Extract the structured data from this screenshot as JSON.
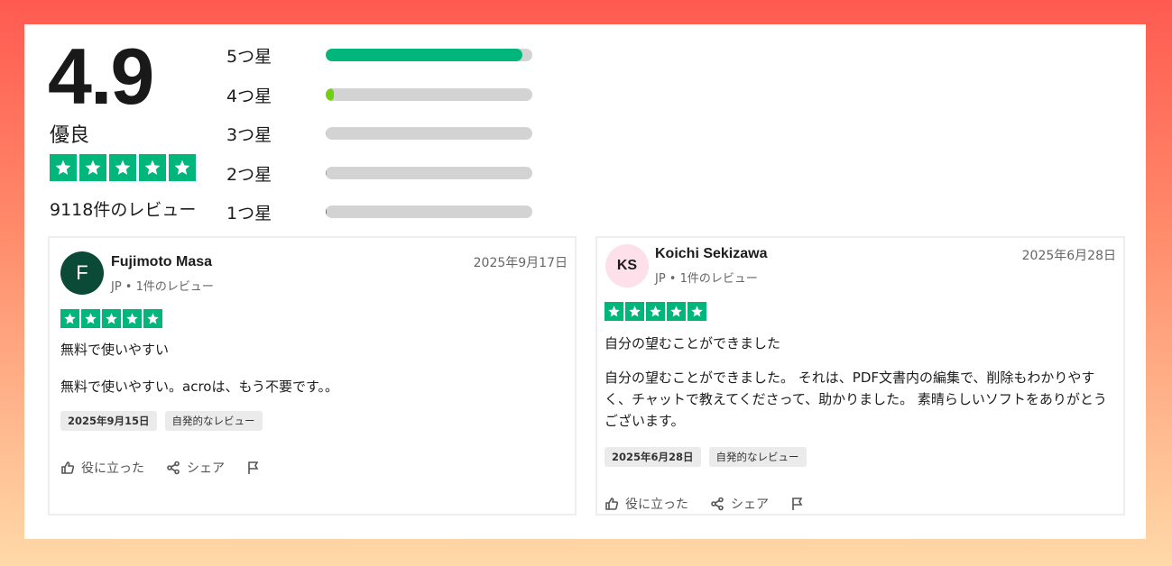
{
  "summary": {
    "score": "4.9",
    "rating_word": "優良",
    "review_count": "9118件のレビュー",
    "star_count": 5,
    "star_color": "#00b67a"
  },
  "distribution": [
    {
      "label": "5つ星",
      "percent": 95,
      "color": "#00b67a"
    },
    {
      "label": "4つ星",
      "percent": 4,
      "color": "#73cf11"
    },
    {
      "label": "3つ星",
      "percent": 0.5,
      "color": "#ffce00"
    },
    {
      "label": "2つ星",
      "percent": 0.5,
      "color": "#ff8622"
    },
    {
      "label": "1つ星",
      "percent": 0.5,
      "color": "#ff3722"
    }
  ],
  "reviews": [
    {
      "avatar": "F",
      "name": "Fujimoto Masa",
      "meta": "JP • 1件のレビュー",
      "date": "2025年9月17日",
      "title": "無料で使いやすい",
      "body": "無料で使いやすい。acroは、もう不要です。。",
      "chip_date": "2025年9月15日",
      "chip_type": "自発的なレビュー",
      "helpful": "役に立った",
      "share": "シェア"
    },
    {
      "avatar": "KS",
      "name": "Koichi Sekizawa",
      "meta": "JP • 1件のレビュー",
      "date": "2025年6月28日",
      "title": "自分の望むことができました",
      "body": "自分の望むことができました。 それは、PDF文書内の編集で、削除もわかりやすく、チャットで教えてくださって、助かりました。 素晴らしいソフトをありがとうございます。",
      "chip_date": "2025年6月28日",
      "chip_type": "自発的なレビュー",
      "helpful": "役に立った",
      "share": "シェア"
    }
  ]
}
